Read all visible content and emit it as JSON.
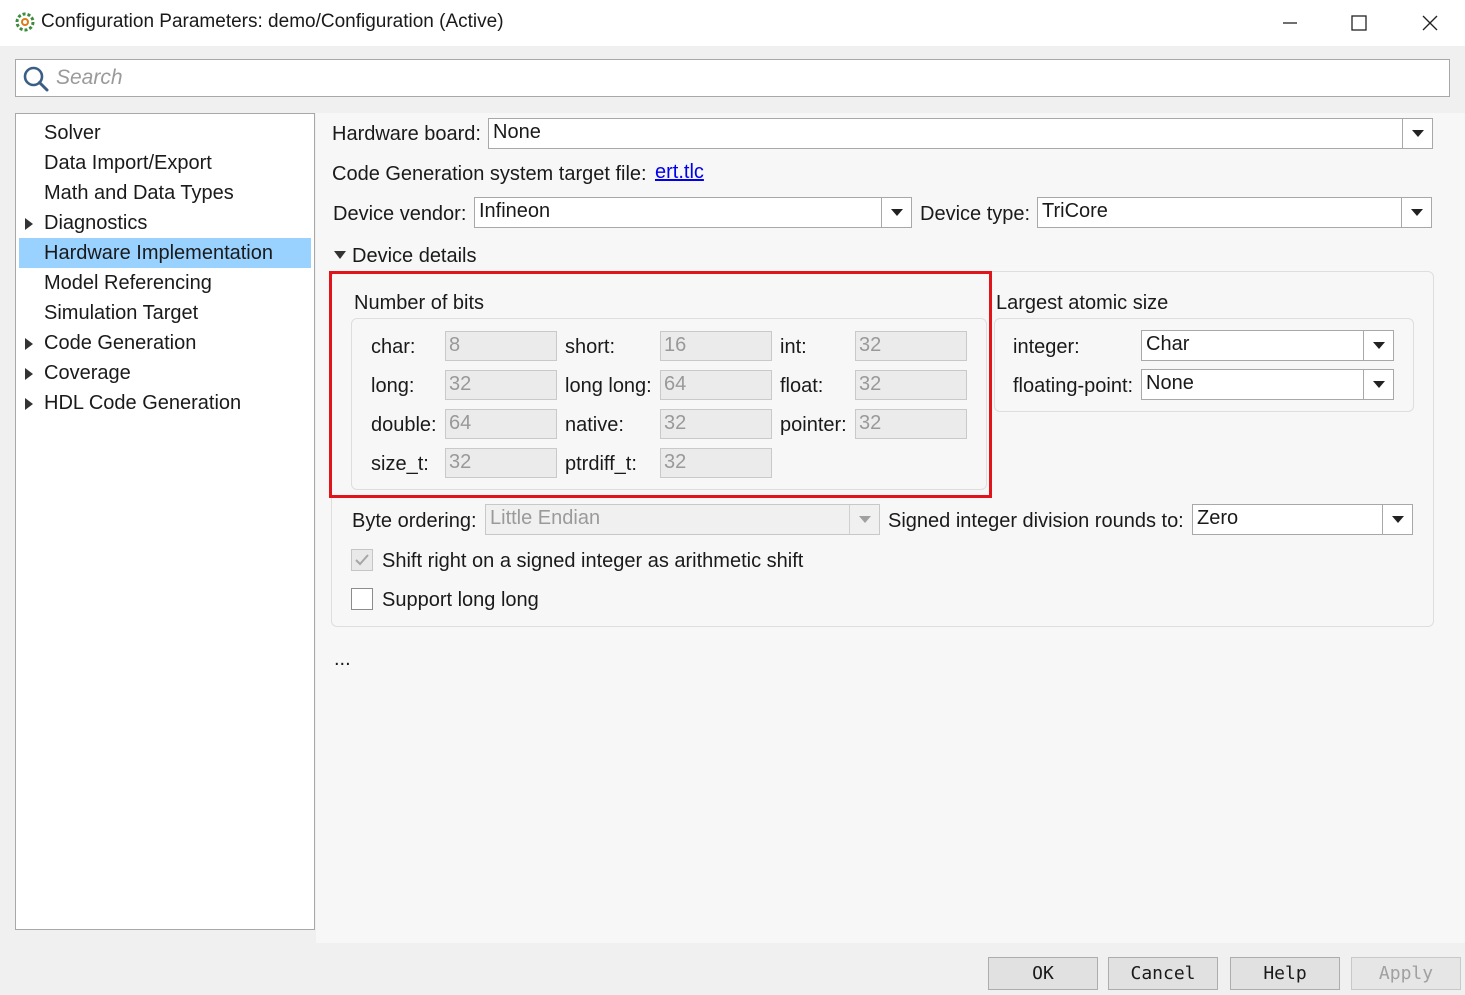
{
  "window": {
    "title": "Configuration Parameters: demo/Configuration (Active)"
  },
  "search": {
    "placeholder": "Search"
  },
  "nav": {
    "items": [
      {
        "label": "Solver",
        "expandable": false
      },
      {
        "label": "Data Import/Export",
        "expandable": false
      },
      {
        "label": "Math and Data Types",
        "expandable": false
      },
      {
        "label": "Diagnostics",
        "expandable": true
      },
      {
        "label": "Hardware Implementation",
        "expandable": false,
        "selected": true
      },
      {
        "label": "Model Referencing",
        "expandable": false
      },
      {
        "label": "Simulation Target",
        "expandable": false
      },
      {
        "label": "Code Generation",
        "expandable": true
      },
      {
        "label": "Coverage",
        "expandable": true
      },
      {
        "label": "HDL Code Generation",
        "expandable": true
      }
    ]
  },
  "hardware": {
    "board_label": "Hardware board:",
    "board_value": "None",
    "target_label": "Code Generation system target file:",
    "target_link": "ert.tlc",
    "vendor_label": "Device vendor:",
    "vendor_value": "Infineon",
    "type_label": "Device type:",
    "type_value": "TriCore",
    "details_label": "Device details"
  },
  "bits": {
    "title": "Number of bits",
    "char_label": "char:",
    "char_value": "8",
    "short_label": "short:",
    "short_value": "16",
    "int_label": "int:",
    "int_value": "32",
    "long_label": "long:",
    "long_value": "32",
    "longlong_label": "long long:",
    "longlong_value": "64",
    "float_label": "float:",
    "float_value": "32",
    "double_label": "double:",
    "double_value": "64",
    "native_label": "native:",
    "native_value": "32",
    "pointer_label": "pointer:",
    "pointer_value": "32",
    "sizet_label": "size_t:",
    "sizet_value": "32",
    "ptrdiff_label": "ptrdiff_t:",
    "ptrdiff_value": "32"
  },
  "atomic": {
    "title": "Largest atomic size",
    "integer_label": "integer:",
    "integer_value": "Char",
    "float_label": "floating-point:",
    "float_value": "None"
  },
  "ordering": {
    "byte_label": "Byte ordering:",
    "byte_value": "Little Endian",
    "division_label": "Signed integer division rounds to:",
    "division_value": "Zero",
    "shift_label": "Shift right on a signed integer as arithmetic shift",
    "shift_checked": true,
    "longlong_label": "Support long long",
    "longlong_checked": false
  },
  "more_label": "...",
  "buttons": {
    "ok": "OK",
    "cancel": "Cancel",
    "help": "Help",
    "apply": "Apply"
  },
  "colors": {
    "selection": "#99d1ff",
    "highlight": "#e0151b",
    "link": "#0000ee"
  }
}
